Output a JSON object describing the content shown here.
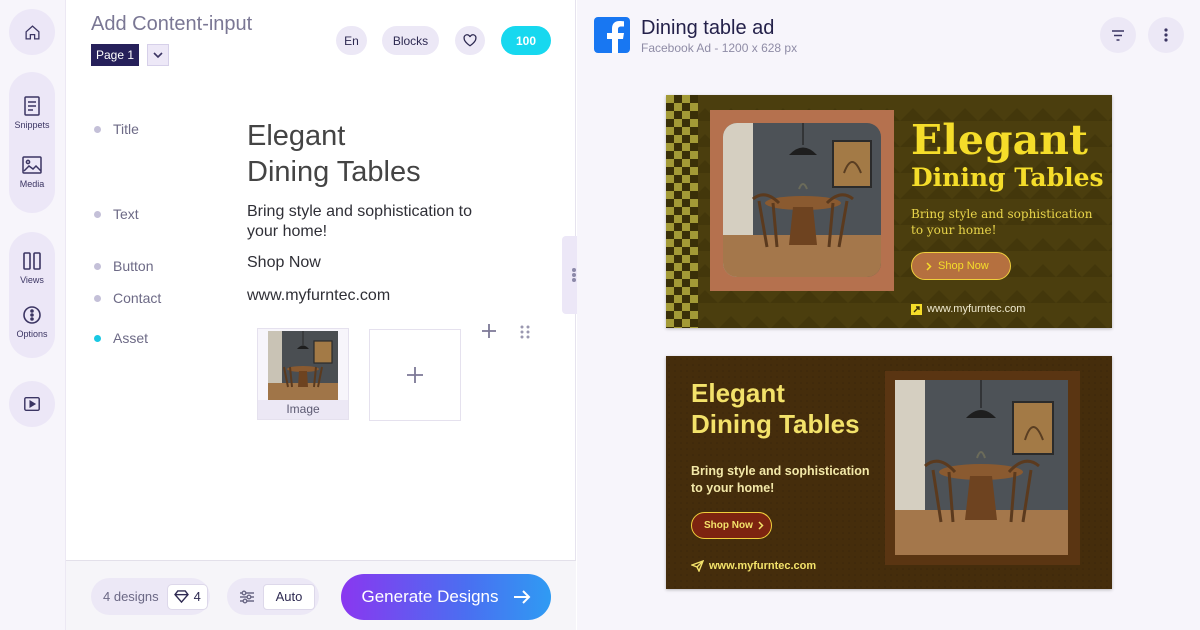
{
  "rail": {
    "snippets_label": "Snippets",
    "media_label": "Media",
    "views_label": "Views",
    "options_label": "Options"
  },
  "panel": {
    "title": "Add Content-input",
    "page_label": "Page 1",
    "lang": "En",
    "blocks": "Blocks",
    "credits": "100"
  },
  "fields": {
    "title_label": "Title",
    "title_line1": "Elegant",
    "title_line2": "Dining Tables",
    "text_label": "Text",
    "text_value": "Bring style and sophistication to your home!",
    "button_label": "Button",
    "button_value": "Shop Now",
    "contact_label": "Contact",
    "contact_value": "www.myfurntec.com",
    "asset_label": "Asset",
    "asset_caption": "Image"
  },
  "footer": {
    "designs": "4 designs",
    "gem_count": "4",
    "mode": "Auto",
    "generate": "Generate Designs"
  },
  "preview": {
    "title": "Dining table ad",
    "subtitle": "Facebook Ad - 1200 x 628 px"
  },
  "ad1": {
    "headline1": "Elegant",
    "headline2": "Dining Tables",
    "body": "Bring style and sophistication to your home!",
    "cta": "Shop Now",
    "url": "www.myfurntec.com"
  },
  "ad2": {
    "headline1": "Elegant",
    "headline2": "Dining Tables",
    "body": "Bring style and sophistication to your home!",
    "cta": "Shop Now",
    "url": "www.myfurntec.com"
  },
  "colors": {
    "accent": "#17d8ef",
    "brand_purple": "#26205a",
    "ad_yellow": "#f5dd2a",
    "facebook_blue": "#1877f2"
  },
  "icons": [
    "home-icon",
    "snippets-icon",
    "media-icon",
    "views-icon",
    "options-icon",
    "play-icon",
    "heart-icon",
    "chevron-down-icon",
    "plus-icon",
    "drag-handle-icon",
    "gem-icon",
    "sliders-icon",
    "arrow-right-icon",
    "facebook-icon",
    "filter-icon",
    "more-vertical-icon"
  ]
}
